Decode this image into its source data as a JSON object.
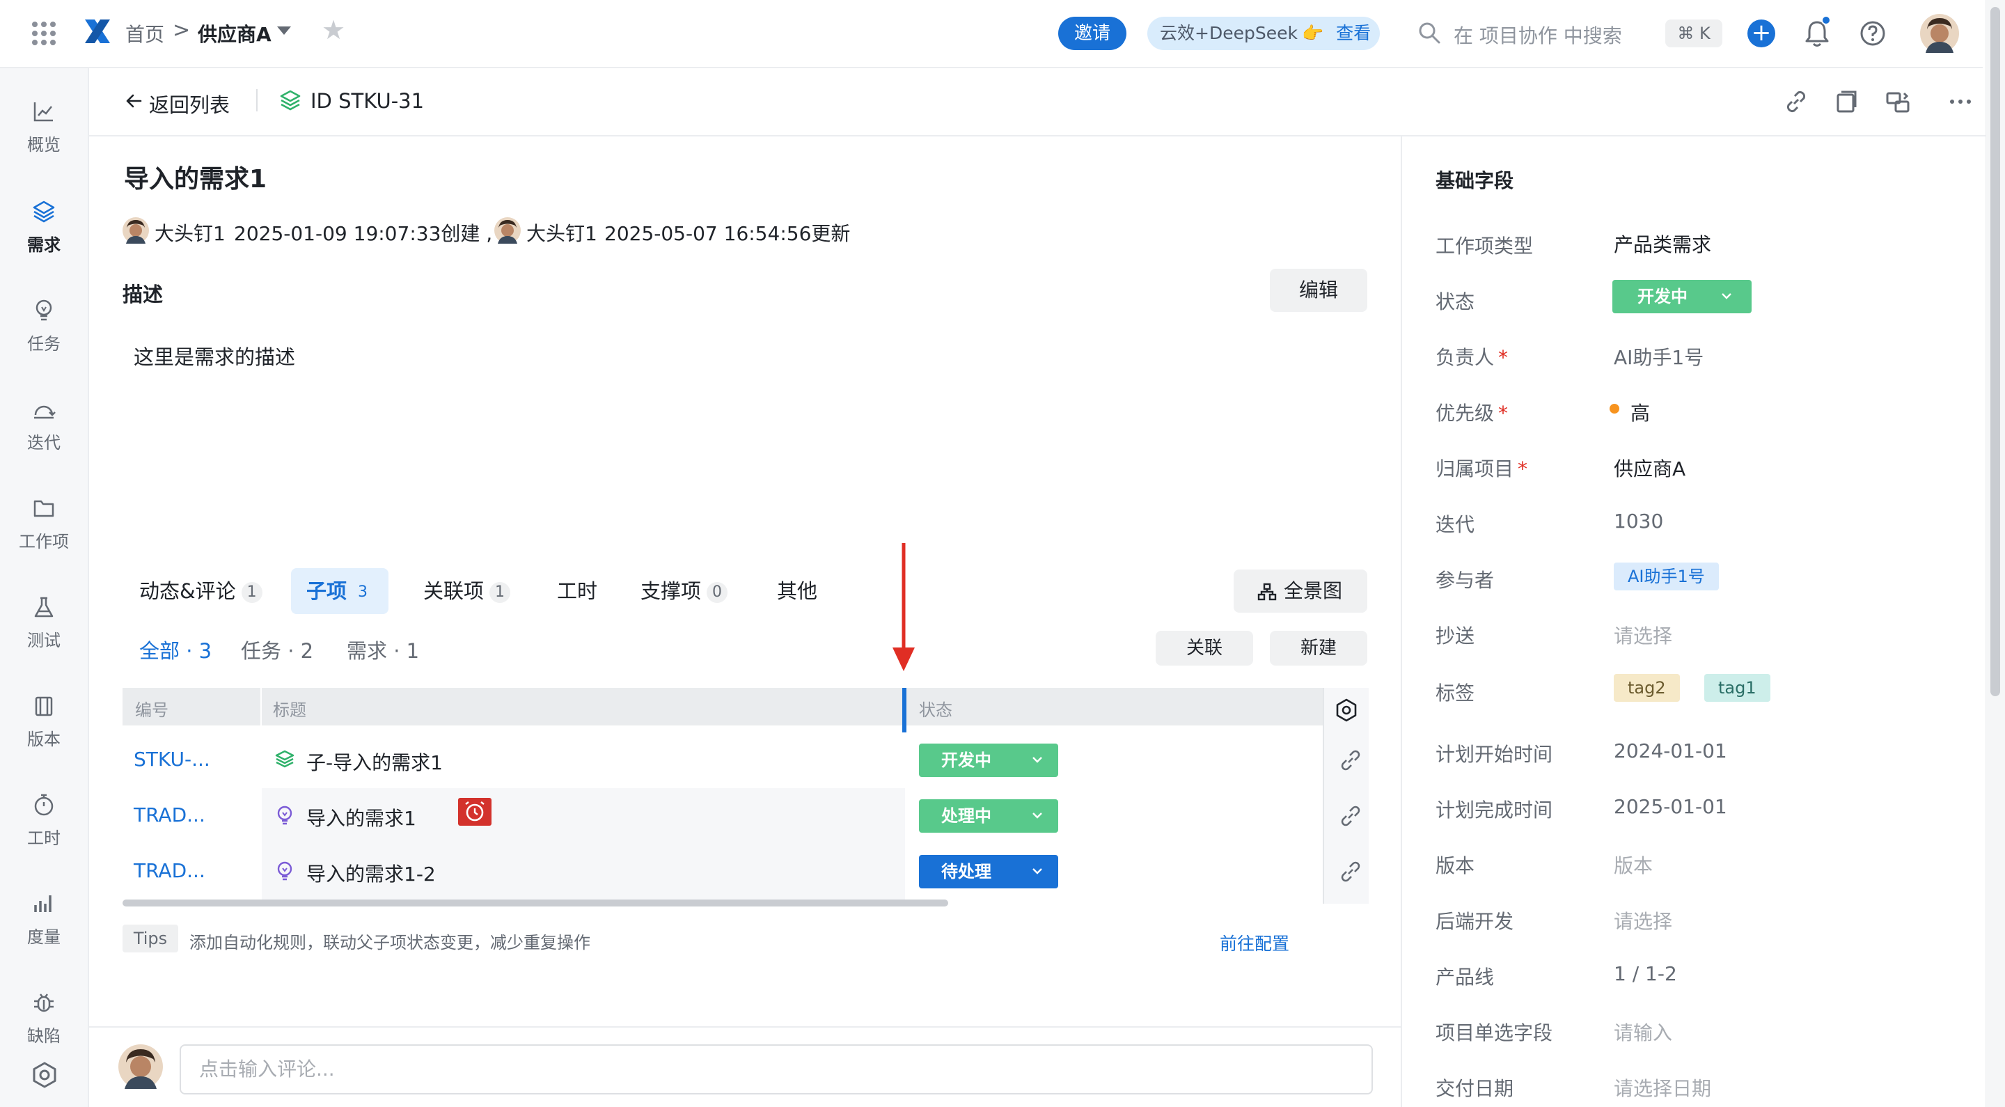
{
  "topbar": {
    "breadcrumb_home": "首页",
    "breadcrumb_sep": ">",
    "project_name": "供应商A",
    "invite_label": "邀请",
    "promo_label": "云效+DeepSeek",
    "promo_emoji": "👉",
    "promo_link": "查看",
    "search_placeholder": "在 项目协作 中搜索",
    "shortcut": "⌘ K",
    "plus": "+"
  },
  "colors": {
    "primary": "#1971d6",
    "status_dev": "#58c98b",
    "status_processing": "#58c98b",
    "status_pending": "#1971d6",
    "priority_high": "#f7931e",
    "arrow": "#e02e24"
  },
  "leftnav": {
    "items": [
      {
        "label": "概览",
        "icon": "chart-line-icon"
      },
      {
        "label": "需求",
        "icon": "layers-icon",
        "active": true
      },
      {
        "label": "任务",
        "icon": "bulb-icon"
      },
      {
        "label": "迭代",
        "icon": "iteration-icon"
      },
      {
        "label": "工作项",
        "icon": "folder-icon"
      },
      {
        "label": "测试",
        "icon": "flask-icon"
      },
      {
        "label": "版本",
        "icon": "version-icon"
      },
      {
        "label": "工时",
        "icon": "stopwatch-icon"
      },
      {
        "label": "度量",
        "icon": "bar-chart-icon"
      },
      {
        "label": "缺陷",
        "icon": "bug-icon"
      }
    ]
  },
  "subheader": {
    "back_label": "返回列表",
    "id_label": "ID STKU-31"
  },
  "detail": {
    "title": "导入的需求1",
    "creator": "大头钉1",
    "created_text": "2025-01-09 19:07:33创建 ,",
    "updater": "大头钉1",
    "updated_text": "2025-05-07 16:54:56更新",
    "desc_label": "描述",
    "edit_label": "编辑",
    "desc_text": "这里是需求的描述"
  },
  "tabs": [
    {
      "label": "动态&评论",
      "count": "1"
    },
    {
      "label": "子项",
      "count": "3",
      "active": true
    },
    {
      "label": "关联项",
      "count": "1"
    },
    {
      "label": "工时",
      "count": ""
    },
    {
      "label": "支撑项",
      "count": "0"
    },
    {
      "label": "其他",
      "count": ""
    }
  ],
  "panorama_label": "全景图",
  "filters": {
    "all": "全部 · 3",
    "task": "任务 · 2",
    "req": "需求 · 1",
    "link_btn": "关联",
    "new_btn": "新建"
  },
  "table": {
    "headers": {
      "id": "编号",
      "title": "标题",
      "status": "状态"
    },
    "rows": [
      {
        "id": "STKU-...",
        "icon": "layers-icon",
        "title": "子-导入的需求1",
        "status": "开发中",
        "status_color": "#58c98b"
      },
      {
        "id": "TRAD...",
        "icon": "bulb-icon",
        "title": "导入的需求1",
        "status": "处理中",
        "status_color": "#58c98b",
        "alarm": true
      },
      {
        "id": "TRAD...",
        "icon": "bulb-icon",
        "title": "导入的需求1-2",
        "status": "待处理",
        "status_color": "#1971d6"
      }
    ]
  },
  "tips": {
    "tag": "Tips",
    "text": "添加自动化规则，联动父子项状态变更，减少重复操作",
    "link": "前往配置"
  },
  "comment": {
    "placeholder": "点击输入评论..."
  },
  "fields": {
    "title": "基础字段",
    "items": [
      {
        "label": "工作项类型",
        "value": "产品类需求",
        "required": false
      },
      {
        "label": "状态",
        "value": "开发中",
        "required": false
      },
      {
        "label": "负责人",
        "value": "AI助手1号",
        "required": true
      },
      {
        "label": "优先级",
        "value": "高",
        "required": true
      },
      {
        "label": "归属项目",
        "value": "供应商A",
        "required": true
      },
      {
        "label": "迭代",
        "value": "1030",
        "required": false
      },
      {
        "label": "参与者",
        "value": "AI助手1号",
        "required": false
      },
      {
        "label": "抄送",
        "value": "请选择",
        "required": false
      },
      {
        "label": "标签",
        "value": "",
        "tags": [
          "tag2",
          "tag1"
        ],
        "required": false
      },
      {
        "label": "计划开始时间",
        "value": "2024-01-01",
        "required": false
      },
      {
        "label": "计划完成时间",
        "value": "2025-01-01",
        "required": false
      },
      {
        "label": "版本",
        "value": "版本",
        "required": false
      },
      {
        "label": "后端开发",
        "value": "请选择",
        "required": false
      },
      {
        "label": "产品线",
        "value": "1 / 1-2",
        "required": false
      },
      {
        "label": "项目单选字段",
        "value": "请输入",
        "required": false
      },
      {
        "label": "交付日期",
        "value": "请选择日期",
        "required": false
      }
    ]
  }
}
